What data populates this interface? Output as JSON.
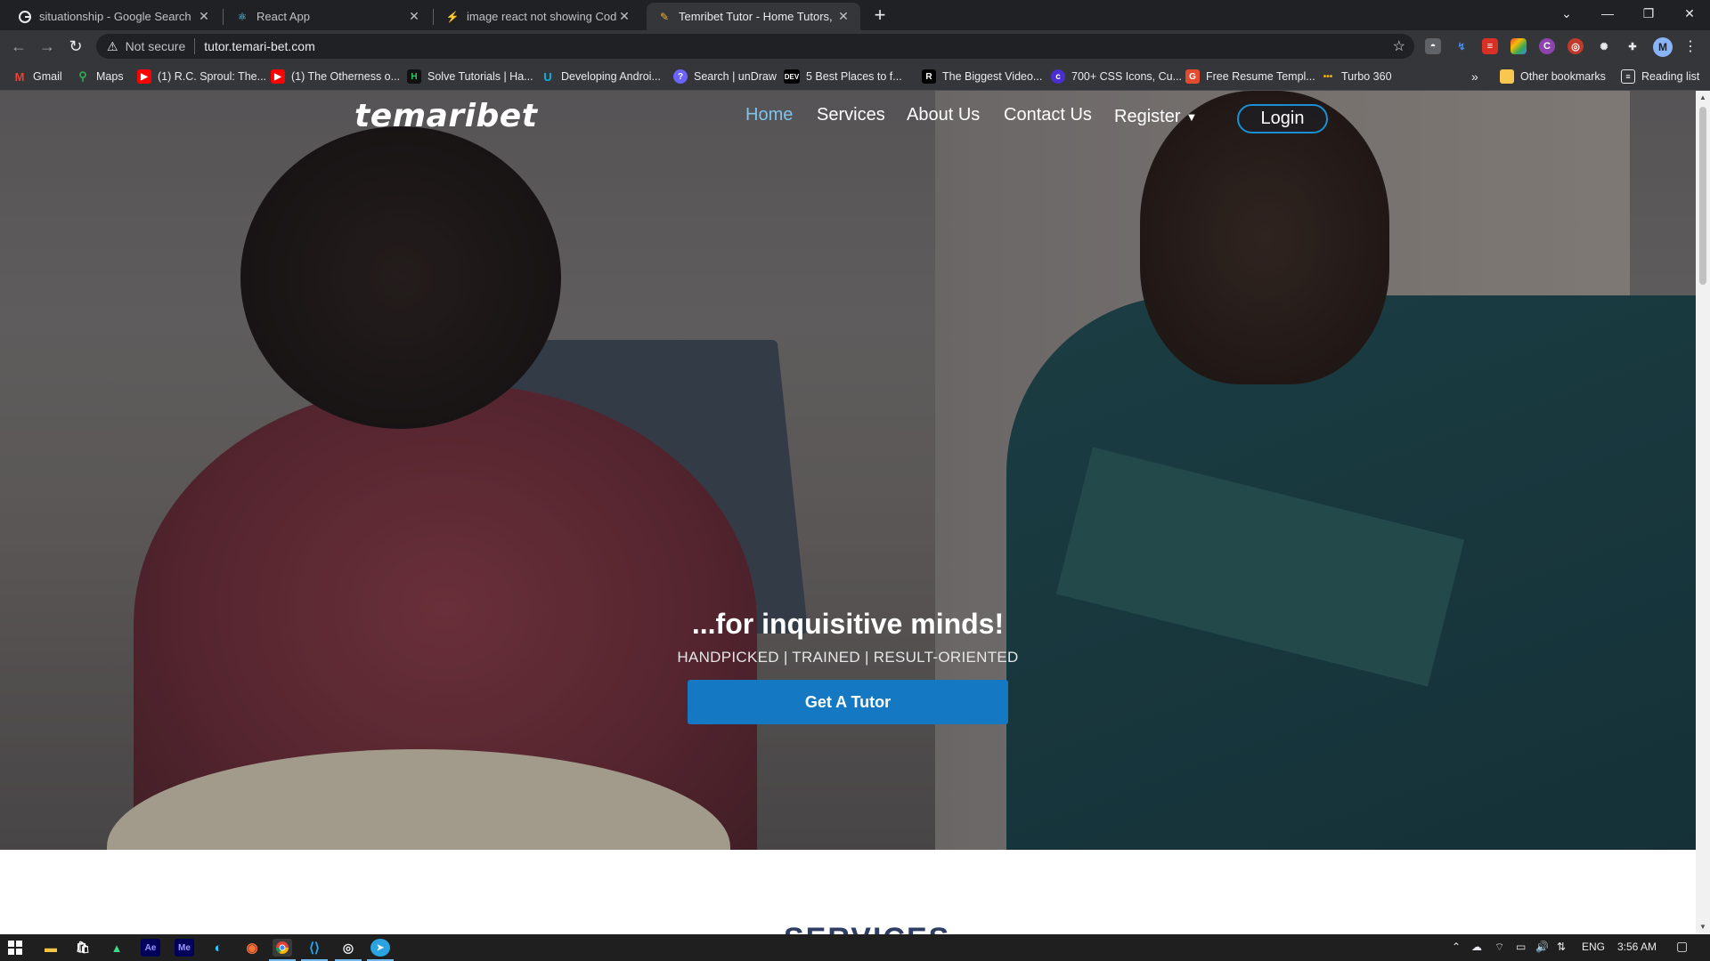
{
  "browser": {
    "tabs": [
      {
        "title": "situationship - Google Search",
        "icon": "google-icon",
        "active": false
      },
      {
        "title": "React App",
        "icon": "react-icon",
        "active": false
      },
      {
        "title": "image react not showing Code E",
        "icon": "grepper-icon",
        "active": false
      },
      {
        "title": "Temribet Tutor - Home Tutors, O",
        "icon": "temaribet-icon",
        "active": true
      }
    ],
    "security_label": "Not secure",
    "url": "tutor.temari-bet.com",
    "profile_initial": "M",
    "bookmarks": [
      {
        "label": "Gmail",
        "icon": "gmail-icon"
      },
      {
        "label": "Maps",
        "icon": "maps-icon"
      },
      {
        "label": "(1) R.C. Sproul: The...",
        "icon": "youtube-icon"
      },
      {
        "label": "(1) The Otherness o...",
        "icon": "youtube-icon"
      },
      {
        "label": "Solve Tutorials | Ha...",
        "icon": "hackerrank-icon"
      },
      {
        "label": "Developing Androi...",
        "icon": "udacity-icon"
      },
      {
        "label": "Search | unDraw",
        "icon": "undraw-icon"
      },
      {
        "label": "5 Best Places to f...",
        "icon": "dev-icon"
      },
      {
        "label": "The Biggest Video...",
        "icon": "r-icon"
      },
      {
        "label": "700+ CSS Icons, Cu...",
        "icon": "css-gg-icon"
      },
      {
        "label": "Free Resume Templ...",
        "icon": "resume-icon"
      },
      {
        "label": "Turbo 360",
        "icon": "turbo-icon"
      }
    ],
    "bookmarks_overflow": "»",
    "other_bookmarks": "Other bookmarks",
    "reading_list": "Reading list"
  },
  "site": {
    "logo": "temaribet",
    "nav": {
      "home": "Home",
      "services": "Services",
      "about": "About Us",
      "contact": "Contact Us",
      "register": "Register",
      "login": "Login"
    },
    "hero": {
      "headline": "...for inquisitive minds!",
      "subline": "HANDPICKED | TRAINED | RESULT-ORIENTED",
      "cta": "Get A Tutor"
    },
    "services_heading": "SERVICES"
  },
  "taskbar": {
    "language": "ENG",
    "time": "3:56 AM"
  },
  "colors": {
    "accent": "#1578c2",
    "nav_active": "#7fc3ec",
    "heading": "#2f3f63"
  }
}
